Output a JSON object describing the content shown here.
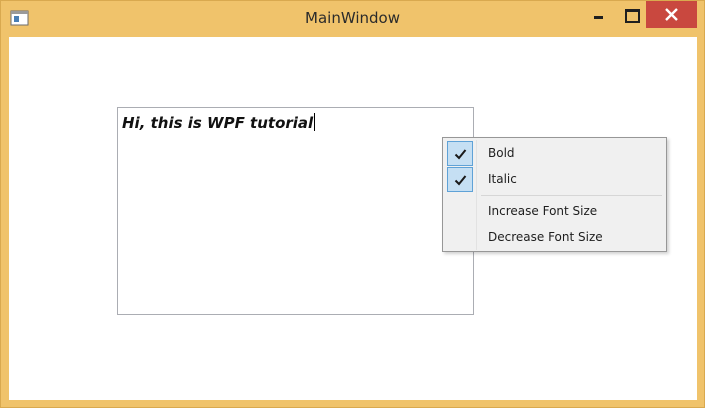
{
  "window": {
    "title": "MainWindow",
    "icon": "app-window-icon",
    "controls": {
      "minimize": "minimize-icon",
      "maximize": "maximize-icon",
      "close": "close-icon"
    },
    "frame_color": "#f0c36b",
    "close_color": "#c9483f"
  },
  "textbox": {
    "text": "Hi, this is WPF tutorial",
    "bold": true,
    "italic": true
  },
  "context_menu": {
    "items": [
      {
        "label": "Bold",
        "checked": true
      },
      {
        "label": "Italic",
        "checked": true
      },
      {
        "label": "Increase Font Size",
        "checked": false
      },
      {
        "label": "Decrease Font Size",
        "checked": false
      }
    ],
    "check_color": "#c5dff3"
  }
}
